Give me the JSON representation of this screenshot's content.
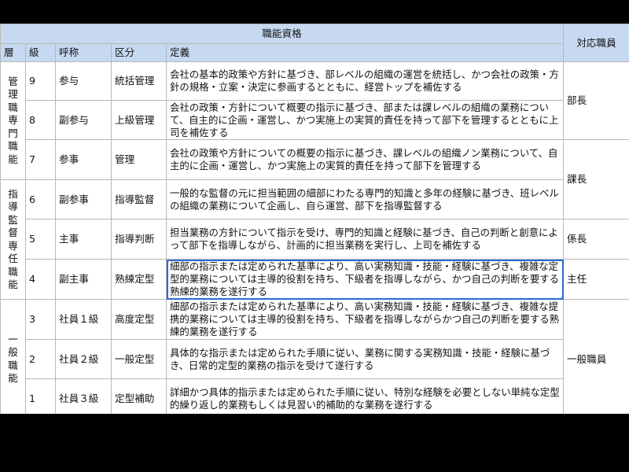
{
  "header": {
    "group_title": "職能資格",
    "corresponding": "対応職員",
    "col_layer": "層",
    "col_grade": "級",
    "col_title": "呼称",
    "col_category": "区分",
    "col_definition": "定義"
  },
  "layers": [
    {
      "label": "管理職専門職能"
    },
    {
      "label": "指導監督専任職能"
    },
    {
      "label": "一般職能"
    }
  ],
  "rows": [
    {
      "grade": "9",
      "title": "参与",
      "category": "統括管理",
      "definition": "会社の基本的政策や方針に基づき、部レベルの組織の運営を統括し、かつ会社の政策・方針の規格・立案・決定に参画するとともに、経営トップを補佐する"
    },
    {
      "grade": "8",
      "title": "副参与",
      "category": "上級管理",
      "definition": "会社の政策・方針について概要の指示に基づき、部または課レベルの組織の業務について、自主的に企画・運営し、かつ実施上の実質的責任を持って部下を管理するとともに上司を補佐する"
    },
    {
      "grade": "7",
      "title": "参事",
      "category": "管理",
      "definition": "会社の政策や方針についての概要の指示に基づき、課レベルの組織ノン業務について、自主的に企画・運営し、かつ実施上の実質的責任を持って部下を管理する"
    },
    {
      "grade": "6",
      "title": "副参事",
      "category": "指導監督",
      "definition": "一般的な監督の元に担当範囲の細部にわたる専門的知識と多年の経験に基づき、班レベルの組織の業務について企画し、自ら運営、部下を指導監督する"
    },
    {
      "grade": "5",
      "title": "主事",
      "category": "指導判断",
      "definition": "担当業務の方針について指示を受け、専門的知識と経験に基づき、自己の判断と創意によって部下を指導しながら、計画的に担当業務を実行し、上司を補佐する"
    },
    {
      "grade": "4",
      "title": "副主事",
      "category": "熟練定型",
      "definition": "細部の指示または定められた基準により、高い実務知識・技能・経験に基づき、複雑な定型的業務については主導的役割を持ち、下級者を指導しながら、かつ自己の判断を要する熟練的業務を遂行する"
    },
    {
      "grade": "3",
      "title": "社員１級",
      "category": "高度定型",
      "definition": "細部の指示または定められた基準により、高い実務知識・技能・経験に基づき、複雑な提携的業務については主導的役割を持ち、下級者を指導しながらかつ自己の判断を要する熟練的業務を遂行する"
    },
    {
      "grade": "2",
      "title": "社員２級",
      "category": "一般定型",
      "definition": "具体的な指示または定められた手順に従い、業務に関する実務知識・技能・経験に基づき、日常的定型的業務の指示を受けて遂行する"
    },
    {
      "grade": "1",
      "title": "社員３級",
      "category": "定型補助",
      "definition": "詳細かつ具体的指示または定められた手順に従い、特別な経験を必要としない単純な定型的繰り返し的業務もしくは見習い的補助的な業務を遂行する"
    }
  ],
  "positions": [
    {
      "label": "部長"
    },
    {
      "label": "課長"
    },
    {
      "label": "係長"
    },
    {
      "label": "主任"
    },
    {
      "label": "一般職員"
    }
  ],
  "selected_cell": "rows.5.definition"
}
